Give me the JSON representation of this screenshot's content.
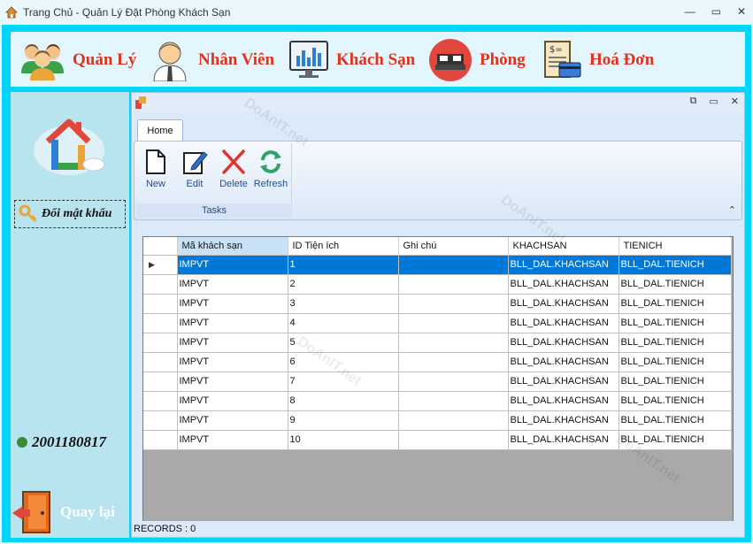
{
  "window": {
    "title": "Trang Chủ - Quản Lý Đặt Phòng Khách Sạn",
    "controls": [
      "—",
      "▭",
      "✕"
    ]
  },
  "top_menu": [
    {
      "label": "Quản Lý",
      "icon": "users-group-icon"
    },
    {
      "label": "Nhân Viên",
      "icon": "employee-icon"
    },
    {
      "label": "Khách Sạn",
      "icon": "monitor-chart-icon"
    },
    {
      "label": "Phòng",
      "icon": "bed-icon"
    },
    {
      "label": "Hoá Đơn",
      "icon": "invoice-icon"
    }
  ],
  "left_panel": {
    "change_password_label": "Đổi mật khẩu",
    "user_id": "2001180817",
    "back_label": "Quay lại"
  },
  "inner_window": {
    "controls": [
      "⧉",
      "▭",
      "✕"
    ],
    "ribbon": {
      "tab": "Home",
      "group_label": "Tasks",
      "buttons": [
        "New",
        "Edit",
        "Delete",
        "Refresh"
      ]
    },
    "grid": {
      "columns": [
        "Mã khách sạn",
        "ID Tiện ích",
        "Ghi chú",
        "KHACHSAN",
        "TIENICH"
      ],
      "rows": [
        [
          "IMPVT",
          "1",
          "",
          "BLL_DAL.KHACHSAN",
          "BLL_DAL.TIENICH"
        ],
        [
          "IMPVT",
          "2",
          "",
          "BLL_DAL.KHACHSAN",
          "BLL_DAL.TIENICH"
        ],
        [
          "IMPVT",
          "3",
          "",
          "BLL_DAL.KHACHSAN",
          "BLL_DAL.TIENICH"
        ],
        [
          "IMPVT",
          "4",
          "",
          "BLL_DAL.KHACHSAN",
          "BLL_DAL.TIENICH"
        ],
        [
          "IMPVT",
          "5",
          "",
          "BLL_DAL.KHACHSAN",
          "BLL_DAL.TIENICH"
        ],
        [
          "IMPVT",
          "6",
          "",
          "BLL_DAL.KHACHSAN",
          "BLL_DAL.TIENICH"
        ],
        [
          "IMPVT",
          "7",
          "",
          "BLL_DAL.KHACHSAN",
          "BLL_DAL.TIENICH"
        ],
        [
          "IMPVT",
          "8",
          "",
          "BLL_DAL.KHACHSAN",
          "BLL_DAL.TIENICH"
        ],
        [
          "IMPVT",
          "9",
          "",
          "BLL_DAL.KHACHSAN",
          "BLL_DAL.TIENICH"
        ],
        [
          "IMPVT",
          "10",
          "",
          "BLL_DAL.KHACHSAN",
          "BLL_DAL.TIENICH"
        ]
      ],
      "selected_row": 0
    },
    "status": "RECORDS : 0"
  },
  "colors": {
    "frame": "#00d6fb",
    "menu_text": "#e0321c",
    "selected_row": "#0078d7"
  }
}
